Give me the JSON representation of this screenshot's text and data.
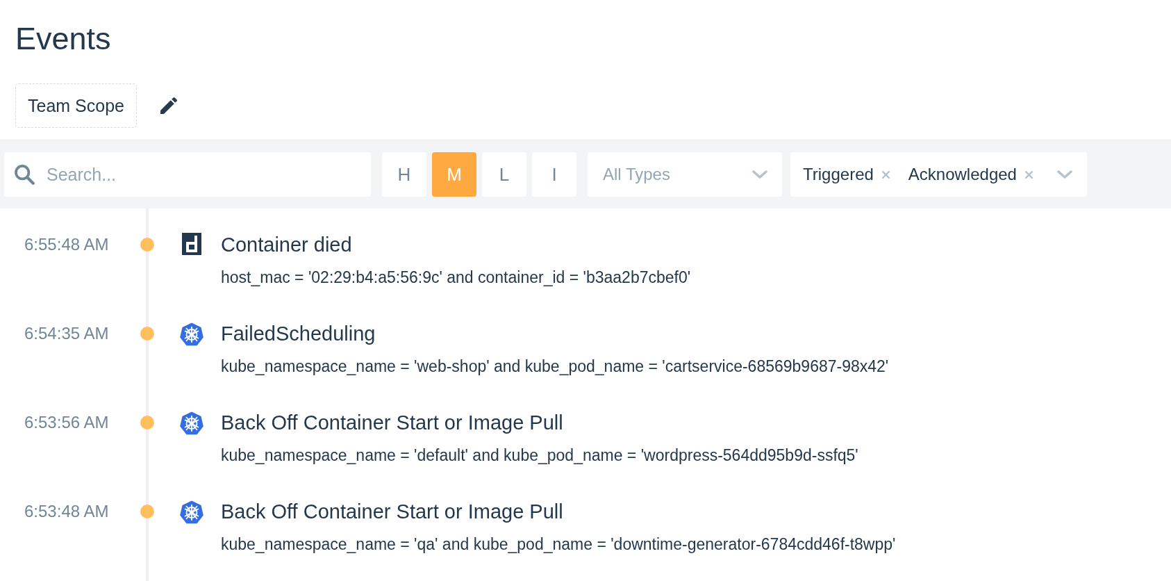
{
  "page": {
    "title": "Events"
  },
  "scope": {
    "label": "Team Scope"
  },
  "search": {
    "placeholder": "Search..."
  },
  "severity_filters": [
    {
      "label": "H",
      "selected": false
    },
    {
      "label": "M",
      "selected": true
    },
    {
      "label": "L",
      "selected": false
    },
    {
      "label": "I",
      "selected": false
    }
  ],
  "type_filter": {
    "placeholder": "All Types"
  },
  "status_filter": {
    "chips": [
      {
        "label": "Triggered"
      },
      {
        "label": "Acknowledged"
      }
    ]
  },
  "events": [
    {
      "time": "6:55:48 AM",
      "color": "#ffbf5f",
      "kind": "docker",
      "title": "Container died",
      "scope": "host_mac = '02:29:b4:a5:56:9c' and container_id = 'b3aa2b7cbef0'"
    },
    {
      "time": "6:54:35 AM",
      "color": "#ffbf5f",
      "kind": "kubernetes",
      "title": "FailedScheduling",
      "scope": "kube_namespace_name = 'web-shop' and kube_pod_name = 'cartservice-68569b9687-98x42'"
    },
    {
      "time": "6:53:56 AM",
      "color": "#ffbf5f",
      "kind": "kubernetes",
      "title": "Back Off Container Start or Image Pull",
      "scope": "kube_namespace_name = 'default' and kube_pod_name = 'wordpress-564dd95b9d-ssfq5'"
    },
    {
      "time": "6:53:48 AM",
      "color": "#ffbf5f",
      "kind": "kubernetes",
      "title": "Back Off Container Start or Image Pull",
      "scope": "kube_namespace_name = 'qa' and kube_pod_name = 'downtime-generator-6784cdd46f-t8wpp'"
    }
  ]
}
